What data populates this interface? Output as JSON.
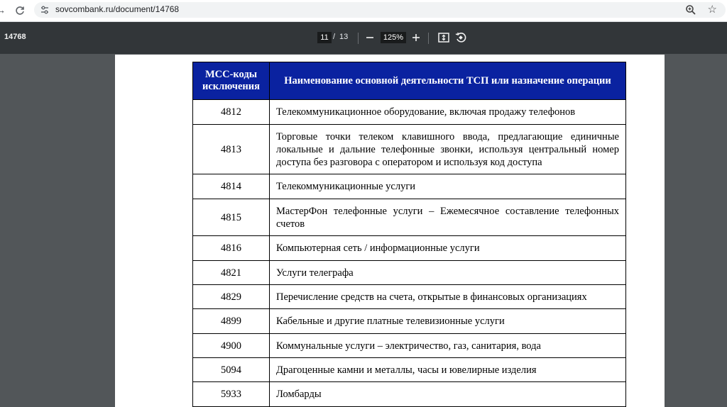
{
  "browser": {
    "url": "sovcombank.ru/document/14768"
  },
  "pdf": {
    "title": "14768",
    "current_page": "11",
    "page_sep": "/",
    "total_pages": "13",
    "zoom": "125%"
  },
  "table": {
    "headers": [
      "MCC-коды исключения",
      "Наименование основной деятельности ТСП или назначение операции"
    ],
    "header_color": "#0a22a0",
    "rows": [
      {
        "code": "4812",
        "desc": "Телекоммуникационное оборудование, включая продажу телефонов"
      },
      {
        "code": "4813",
        "desc": "Торговые точки телеком клавишного ввода, предлагающие единичные локальные и дальние телефонные звонки, используя центральный номер доступа без разговора с оператором и используя код доступа"
      },
      {
        "code": "4814",
        "desc": "Телекоммуникационные услуги"
      },
      {
        "code": "4815",
        "desc": "МастерФон телефонные услуги – Ежемесячное составление телефонных счетов"
      },
      {
        "code": "4816",
        "desc": "Компьютерная сеть / информационные услуги"
      },
      {
        "code": "4821",
        "desc": "Услуги телеграфа"
      },
      {
        "code": "4829",
        "desc": "Перечисление средств на счета, открытые в финансовых организациях"
      },
      {
        "code": "4899",
        "desc": "Кабельные и другие платные телевизионные услуги"
      },
      {
        "code": "4900",
        "desc": "Коммунальные услуги – электричество, газ, санитария, вода"
      },
      {
        "code": "5094",
        "desc": "Драгоценные камни и металлы, часы и ювелирные изделия"
      },
      {
        "code": "5933",
        "desc": "Ломбарды"
      }
    ]
  }
}
